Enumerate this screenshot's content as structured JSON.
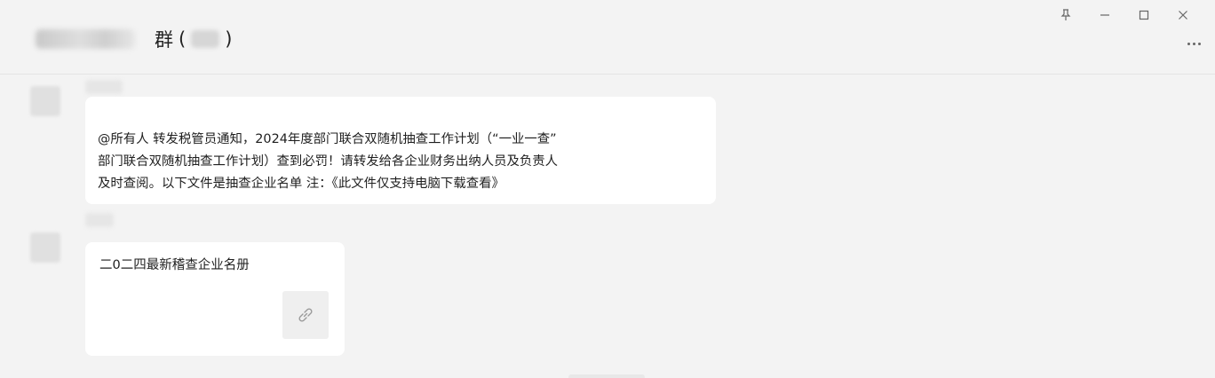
{
  "chat": {
    "title_text": "群",
    "title_paren_open": "(",
    "title_paren_close": ")"
  },
  "window_controls": {
    "pin": "⊥",
    "minimize": "–",
    "maximize": "□",
    "close": "✕"
  },
  "messages": [
    {
      "lines": [
        "@所有人 转发税管员通知，2024年度部门联合双随机抽查工作计划（“一业一查”",
        "部门联合双随机抽查工作计划）查到必罚！请转发给各企业财务出纳人员及负责人",
        "及时查阅。以下文件是抽查企业名单  注：《此文件仅支持电脑下载查看》"
      ]
    },
    {
      "file_name": "二0二四最新稽查企业名册",
      "icon": "link-icon"
    }
  ]
}
